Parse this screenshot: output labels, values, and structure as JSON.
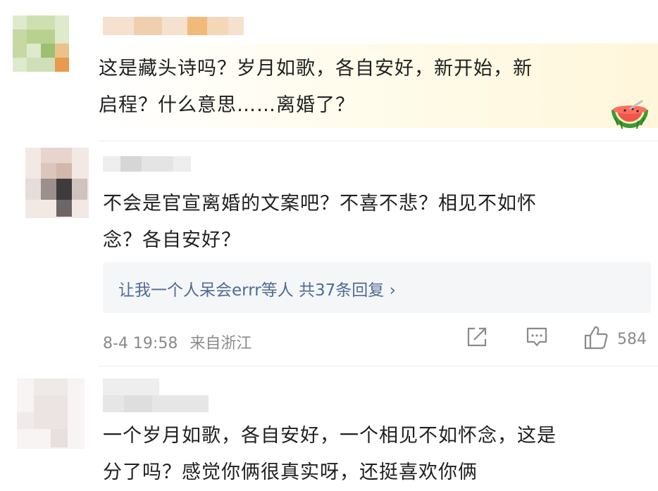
{
  "comments": [
    {
      "text_line1": "这是藏头诗吗？岁月如歌，各自安好，新开始，新",
      "text_line2": "启程？什么意思……离婚了？"
    },
    {
      "text_line1": "不会是官宣离婚的文案吧？不喜不悲？相见不如怀",
      "text_line2": "念？各自安好？",
      "replies_summary": "让我一个人呆会errr等人  共37条回复 ›",
      "timestamp": "8-4 19:58",
      "location": "来自浙江",
      "like_count": "584"
    },
    {
      "text_line1": "一个岁月如歌，各自安好，一个相见不如怀念，这是",
      "text_line2": "分了吗？感觉你俩很真实呀，还挺喜欢你俩"
    }
  ],
  "icons": {
    "share": "share-icon",
    "comment": "comment-icon",
    "like": "thumbs-up-icon",
    "badge": "watermelon-icon"
  },
  "colors": {
    "link": "#4f6b93",
    "meta": "#8a8a8a",
    "highlight": "#fff6db"
  }
}
